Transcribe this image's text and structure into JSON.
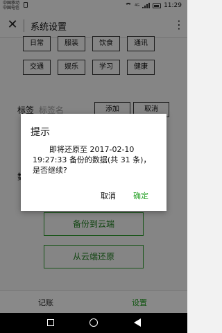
{
  "status_bar": {
    "carrier_1": "中国移动",
    "carrier_2": "中国电信",
    "network_label": "4G",
    "time": "11:29"
  },
  "app_bar": {
    "title": "系统设置"
  },
  "tags": {
    "row1": [
      "日常",
      "服装",
      "饮食",
      "通讯"
    ],
    "row2": [
      "交通",
      "娱乐",
      "学习",
      "健康"
    ],
    "label": "标签",
    "placeholder": "标签名",
    "add_button": "添加",
    "cancel_button": "取消"
  },
  "data_section": {
    "label_visible": "数"
  },
  "backup": {
    "backup_button": "备份到云端",
    "restore_button": "从云端还原"
  },
  "dialog": {
    "title": "提示",
    "message": "即将还原至 2017-02-10 19:27:33 备份的数据(共 31 条)，是否继续?",
    "cancel": "取消",
    "confirm": "确定"
  },
  "bottom_nav": {
    "tabs": [
      {
        "label": "记账"
      },
      {
        "label": "设置"
      }
    ],
    "active_color": "#1f9a1f"
  },
  "colors": {
    "accent": "#2fa52f"
  }
}
